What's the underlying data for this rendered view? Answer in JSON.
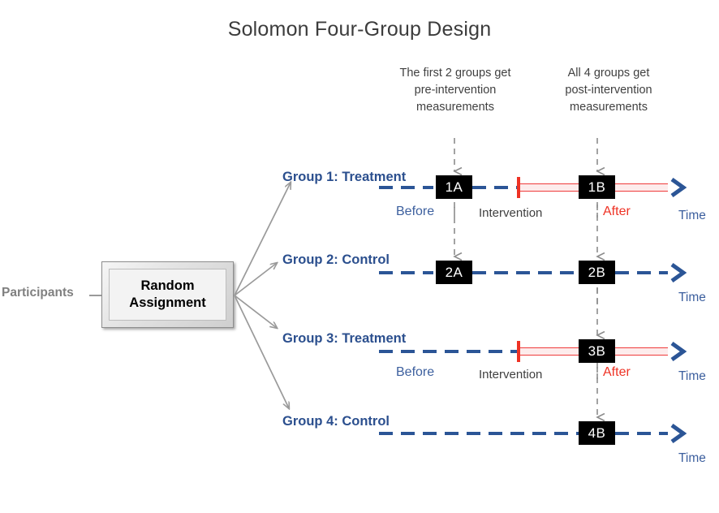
{
  "title": "Solomon Four-Group Design",
  "callouts": {
    "pre": "The first 2 groups get\npre-intervention\nmeasurements",
    "post": "All 4 groups get\npost-intervention\nmeasurements"
  },
  "participants_label": "Participants",
  "random_assignment_label": "Random\nAssignment",
  "axis": {
    "time_label": "Time",
    "before_label": "Before",
    "after_label": "After",
    "intervention_label": "Intervention"
  },
  "colors": {
    "group_label_blue": "#2b4f8e",
    "timeline_blue": "#2b5596",
    "after_red": "#ee3224",
    "hatch_red": "#ef3b3b",
    "arrow_gray": "#9a9a9a",
    "title_gray": "#3c3c3c",
    "participants_gray": "#808080"
  },
  "rows": [
    {
      "label": "Group 1: Treatment",
      "pre_box": "1A",
      "post_box": "1B",
      "has_intervention": true,
      "before_label": "Before",
      "after_label": "After",
      "intervention_label": "Intervention",
      "time_label": "Time"
    },
    {
      "label": "Group 2: Control",
      "pre_box": "2A",
      "post_box": "2B",
      "has_intervention": false,
      "before_label": "",
      "after_label": "",
      "intervention_label": "",
      "time_label": "Time"
    },
    {
      "label": "Group 3: Treatment",
      "pre_box": "",
      "post_box": "3B",
      "has_intervention": true,
      "before_label": "Before",
      "after_label": "After",
      "intervention_label": "Intervention",
      "time_label": "Time"
    },
    {
      "label": "Group 4: Control",
      "pre_box": "",
      "post_box": "4B",
      "has_intervention": false,
      "before_label": "",
      "after_label": "",
      "intervention_label": "",
      "time_label": "Time"
    }
  ]
}
